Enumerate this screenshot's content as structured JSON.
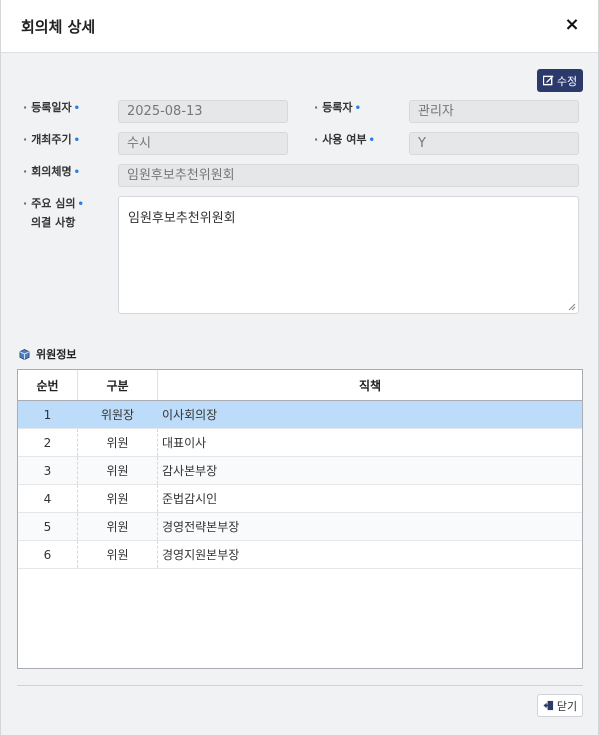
{
  "dialog": {
    "title": "회의체 상세",
    "close_glyph": "×",
    "edit_label": "수정",
    "footer_close_label": "닫기"
  },
  "form": {
    "reg_date": {
      "label": "등록일자",
      "value": "2025-08-13"
    },
    "registrant": {
      "label": "등록자",
      "value": "관리자"
    },
    "cycle": {
      "label": "개최주기",
      "value": "수시"
    },
    "in_use": {
      "label": "사용 여부",
      "value": "Y"
    },
    "name": {
      "label": "회의체명",
      "value": "임원후보추천위원회"
    },
    "matters": {
      "label_line1": "주요 심의",
      "label_line2": "의결 사항",
      "value": "임원후보추천위원회"
    },
    "required_mark": "•",
    "bullet": "·"
  },
  "members": {
    "section_title": "위원정보",
    "columns": [
      "순번",
      "구분",
      "직책"
    ],
    "rows": [
      {
        "no": "1",
        "type": "위원장",
        "position": "이사회의장"
      },
      {
        "no": "2",
        "type": "위원",
        "position": "대표이사"
      },
      {
        "no": "3",
        "type": "위원",
        "position": "감사본부장"
      },
      {
        "no": "4",
        "type": "위원",
        "position": "준법감시인"
      },
      {
        "no": "5",
        "type": "위원",
        "position": "경영전략본부장"
      },
      {
        "no": "6",
        "type": "위원",
        "position": "경영지원본부장"
      }
    ],
    "selected_row": 0
  },
  "colors": {
    "accent": "#2b3a6b",
    "required": "#2b7de0",
    "selected_row": "#bcdcf9"
  },
  "icons": {
    "edit": "edit-icon",
    "close": "close-icon",
    "section": "cube-icon",
    "exit": "exit-icon"
  }
}
